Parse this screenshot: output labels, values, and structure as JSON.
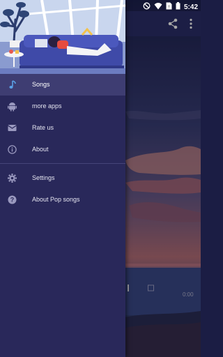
{
  "status_bar": {
    "time": "5:42",
    "icons": [
      "blocked-icon",
      "wifi-icon",
      "sim-icon",
      "battery-icon"
    ]
  },
  "app_bar": {
    "actions": [
      "share-icon",
      "more-vert-icon"
    ]
  },
  "drawer": {
    "items": [
      {
        "label": "Songs",
        "icon": "music-note-icon",
        "active": true
      },
      {
        "label": "more apps",
        "icon": "android-icon",
        "active": false
      },
      {
        "label": "Rate us",
        "icon": "email-icon",
        "active": false
      },
      {
        "label": "About",
        "icon": "info-icon",
        "active": false
      }
    ],
    "secondary_items": [
      {
        "label": "Settings",
        "icon": "gear-icon"
      },
      {
        "label": "About Pop songs",
        "icon": "help-icon"
      }
    ]
  },
  "player": {
    "time": "0:00"
  },
  "colors": {
    "drawer_bg": "#29285a",
    "active_bg": "#3e3d72",
    "accent": "#5aa0e6"
  }
}
